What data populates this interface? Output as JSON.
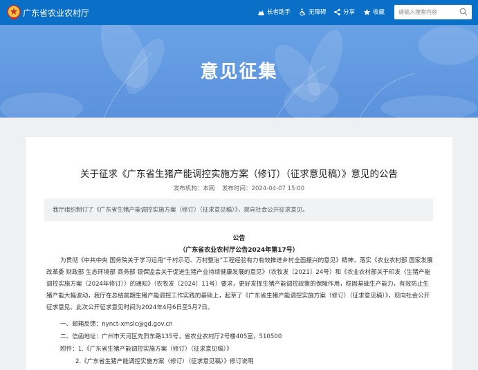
{
  "header": {
    "site_name": "广东省农业农村厅",
    "tools": [
      "长者助手",
      "无障碍",
      "分享",
      "收藏"
    ],
    "search_placeholder": "请输入搜索内容"
  },
  "banner": {
    "title": "意见征集"
  },
  "article": {
    "title": "关于征求《广东省生猪产能调控实施方案（修订）（征求意见稿）》意见的公告",
    "publisher": "发布机构：本网",
    "publish_time": "发布时间：2024-04-07 15:00",
    "summary": "我厅组织制订了《广东省生猪产能调控实施方案（修订）（征求意见稿）》，现向社会公开征求意见。",
    "heading": "公告",
    "subheading": "（广东省农业农村厅公告2024年第17号）",
    "body": "为贯彻《中共中央 国务院关于学习运用“千村示范、万村整治”工程经验有力有效推进乡村全面振兴的意见》精神，落实《农业农村部 国家发展改革委 财政部 生态环境部 商务部 银保监会关于促进生猪产业持续健康发展的意见》（农牧发〔2021〕24号）和《农业农村部关于印发〈生猪产能调控实施方案（2024年修订）〉的通知》（农牧发〔2024〕11号）要求，更好发挥生猪产能调控政策的保障作用，稳固基础生产能力，有效防止生猪产能大幅波动，我厅在总结前期生猪产能调控工作实践的基础上，起草了《广东省生猪产能调控实施方案（修订）（征求意见稿）》，现向社会公开征求意见。此次公开征求意见时间为2024年4月6日至5月7日。",
    "email": "一、邮箱反馈：nynct-xmslc@gd.gov.cn",
    "address": "二、信函地址：广州市天河区先烈东路135号，省农业农村厅2号楼405室，510500",
    "attachment_1": "附件：1.《广东省生猪产能调控实施方案（修订）（征求意见稿）》",
    "attachment_2": "2.《广东省生猪产能调控实施方案（修订）（征求意见稿）》修订说明"
  },
  "colors": {
    "topbar": "#0a6fc7",
    "banner": "#6aa2e6"
  }
}
